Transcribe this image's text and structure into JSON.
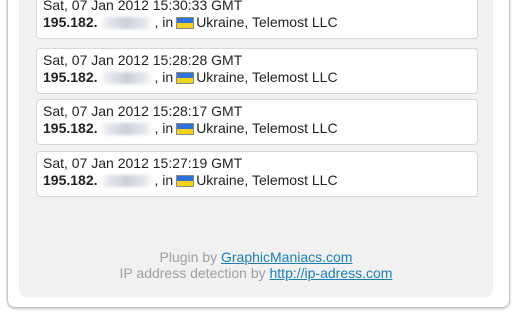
{
  "entries": [
    {
      "timestamp": "Sat, 07 Jan 2012 15:30:33 GMT",
      "ip_prefix": "195.182.",
      "in_text": ", in",
      "flag_icon": "ukraine-flag-icon",
      "location": "Ukraine, Telemost LLC"
    },
    {
      "timestamp": "Sat, 07 Jan 2012 15:28:28 GMT",
      "ip_prefix": "195.182.",
      "in_text": ", in",
      "flag_icon": "ukraine-flag-icon",
      "location": "Ukraine, Telemost LLC"
    },
    {
      "timestamp": "Sat, 07 Jan 2012 15:28:17 GMT",
      "ip_prefix": "195.182.",
      "in_text": ", in",
      "flag_icon": "ukraine-flag-icon",
      "location": "Ukraine, Telemost LLC"
    },
    {
      "timestamp": "Sat, 07 Jan 2012 15:27:19 GMT",
      "ip_prefix": "195.182.",
      "in_text": ", in",
      "flag_icon": "ukraine-flag-icon",
      "location": "Ukraine, Telemost LLC"
    }
  ],
  "footer": {
    "plugin_prefix": "Plugin by ",
    "plugin_link": "GraphicManiacs.com",
    "detection_prefix": "IP address detection by ",
    "detection_link": "http://ip-adress.com"
  },
  "colors": {
    "link": "#1a7fb5",
    "footer_text": "#a0a0a0",
    "flag_blue": "#2f73d8",
    "flag_yellow": "#f2d21a"
  }
}
